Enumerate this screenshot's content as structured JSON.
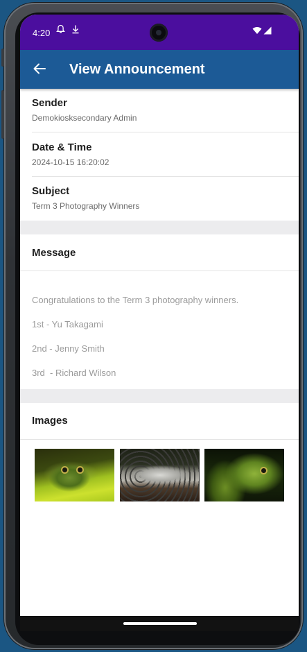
{
  "status_bar": {
    "time": "4:20",
    "icons": [
      "bell-icon",
      "download-icon",
      "wifi-icon",
      "signal-icon"
    ]
  },
  "app_bar": {
    "title": "View Announcement",
    "back_icon": "arrow-back-icon"
  },
  "sender": {
    "label": "Sender",
    "value": "Demokiosksecondary Admin"
  },
  "datetime": {
    "label": "Date & Time",
    "value": "2024-10-15 16:20:02"
  },
  "subject": {
    "label": "Subject",
    "value": "Term 3 Photography Winners"
  },
  "message": {
    "label": "Message",
    "lines": [
      "Congratulations to the Term 3 photography winners.",
      "1st - Yu Takagami",
      "2nd - Jenny Smith",
      "3rd  - Richard Wilson"
    ]
  },
  "images": {
    "label": "Images",
    "items": [
      "frog-photo",
      "snow-leopard-photo",
      "iguana-photo"
    ]
  },
  "colors": {
    "status_bar": "#4b0e9e",
    "app_bar": "#1c5a96",
    "background": "#1b5683"
  }
}
